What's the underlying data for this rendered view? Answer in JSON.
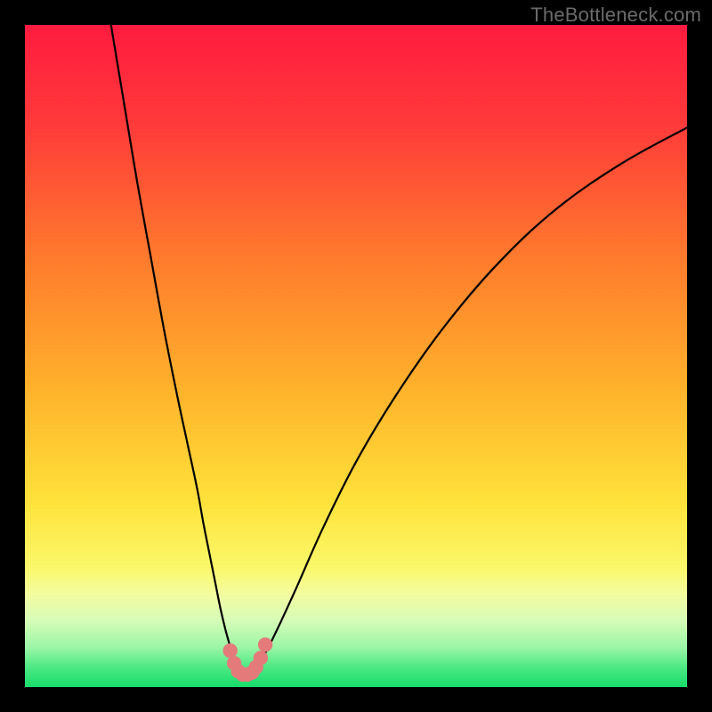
{
  "watermark": "TheBottleneck.com",
  "chart_data": {
    "type": "line",
    "title": "",
    "xlabel": "",
    "ylabel": "",
    "xlim": [
      0,
      100
    ],
    "ylim": [
      0,
      100
    ],
    "grid": false,
    "legend": false,
    "gradient_stops": [
      {
        "offset": 0.0,
        "color": "#ff1b3f"
      },
      {
        "offset": 0.15,
        "color": "#ff3a3a"
      },
      {
        "offset": 0.35,
        "color": "#ff7a2d"
      },
      {
        "offset": 0.55,
        "color": "#ffb22b"
      },
      {
        "offset": 0.72,
        "color": "#ffe23a"
      },
      {
        "offset": 0.82,
        "color": "#faf86a"
      },
      {
        "offset": 0.86,
        "color": "#f4fca0"
      },
      {
        "offset": 0.9,
        "color": "#d6fcb8"
      },
      {
        "offset": 0.94,
        "color": "#9bf6a6"
      },
      {
        "offset": 0.97,
        "color": "#4de884"
      },
      {
        "offset": 1.0,
        "color": "#17dd6b"
      }
    ],
    "series": [
      {
        "name": "left-branch",
        "x": [
          13.0,
          15.0,
          17.0,
          19.0,
          21.0,
          23.0,
          24.5,
          26.0,
          27.0,
          28.0,
          28.8,
          29.5,
          30.2,
          30.8,
          31.3,
          31.8,
          32.2,
          32.8,
          33.5
        ],
        "y": [
          100.0,
          88.0,
          76.0,
          65.0,
          54.0,
          44.0,
          37.0,
          30.0,
          24.5,
          19.5,
          15.5,
          12.0,
          9.0,
          6.8,
          5.2,
          4.0,
          3.2,
          2.4,
          2.0
        ]
      },
      {
        "name": "right-branch",
        "x": [
          33.5,
          34.5,
          36.0,
          38.0,
          41.0,
          45.0,
          50.0,
          56.0,
          63.0,
          71.0,
          80.0,
          90.0,
          100.0
        ],
        "y": [
          2.0,
          2.8,
          4.6,
          8.5,
          15.0,
          24.0,
          34.0,
          44.0,
          54.0,
          63.5,
          72.0,
          79.0,
          84.5
        ]
      }
    ],
    "valley_markers": {
      "color": "#e47a7a",
      "radius": 1.1,
      "points": [
        {
          "x": 31.0,
          "y": 5.5
        },
        {
          "x": 31.6,
          "y": 3.6
        },
        {
          "x": 32.2,
          "y": 2.4
        },
        {
          "x": 32.9,
          "y": 1.9
        },
        {
          "x": 33.6,
          "y": 1.9
        },
        {
          "x": 34.3,
          "y": 2.2
        },
        {
          "x": 34.9,
          "y": 3.0
        },
        {
          "x": 35.6,
          "y": 4.4
        },
        {
          "x": 36.3,
          "y": 6.4
        }
      ]
    }
  }
}
